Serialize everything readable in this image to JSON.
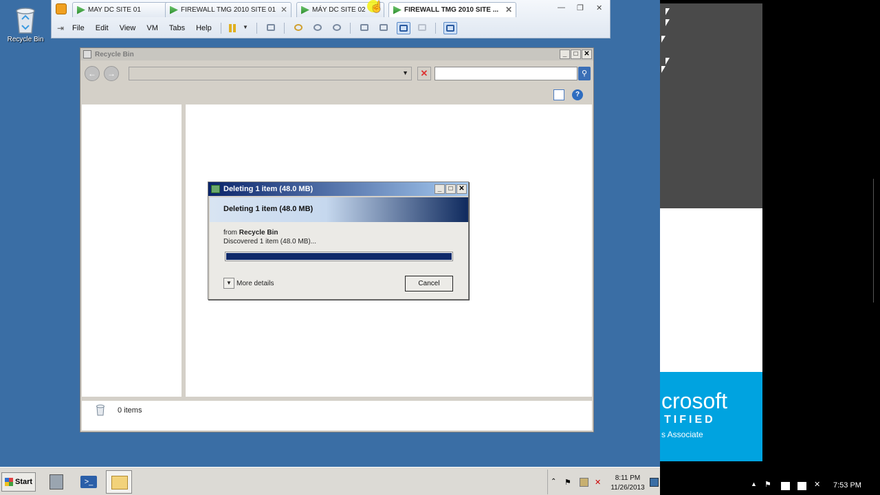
{
  "desktop": {
    "icons": [
      {
        "label": "Recycle Bin",
        "icon": "recycle-bin-icon"
      }
    ]
  },
  "vmware": {
    "tabs": [
      {
        "label": "MAY DC SITE 01",
        "active": false
      },
      {
        "label": "FIREWALL TMG 2010 SITE 01",
        "active": false
      },
      {
        "label": "MÁY DC SITE 02",
        "active": false
      },
      {
        "label": "FIREWALL TMG 2010 SITE ...",
        "active": true
      }
    ],
    "menu": [
      "File",
      "Edit",
      "View",
      "VM",
      "Tabs",
      "Help"
    ]
  },
  "explorer": {
    "title": "Recycle Bin",
    "address": "",
    "search_placeholder": "",
    "status_items": "0 items"
  },
  "dialog": {
    "title": "Deleting 1 item (48.0 MB)",
    "header": "Deleting 1 item (48.0 MB)",
    "from_prefix": "from",
    "from_location": "Recycle Bin",
    "discovered": "Discovered 1 item (48.0 MB)...",
    "progress": 1.0,
    "more_details": "More details",
    "cancel": "Cancel"
  },
  "guest_taskbar": {
    "start": "Start",
    "time": "8:11 PM",
    "date": "11/26/2013"
  },
  "host": {
    "promo_line1": "crosoft",
    "promo_line2": "TIFIED",
    "promo_line3": "s Associate",
    "time": "7:53 PM"
  },
  "colors": {
    "desktop": "#3a6ea5",
    "progress_fill": "#102a6a",
    "promo": "#00a3e0"
  }
}
